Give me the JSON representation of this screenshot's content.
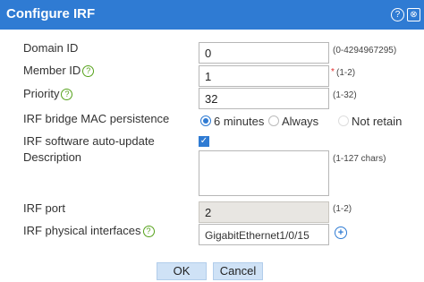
{
  "dialog": {
    "title": "Configure IRF",
    "help_icon": "?",
    "close_icon": "⊗"
  },
  "fields": {
    "domain_id": {
      "label": "Domain ID",
      "value": "0",
      "hint": "(0-4294967295)"
    },
    "member_id": {
      "label": "Member ID",
      "value": "1",
      "hint": "(1-2)",
      "required": "*"
    },
    "priority": {
      "label": "Priority",
      "value": "32",
      "hint": "(1-32)"
    },
    "mac_persistence": {
      "label": "IRF bridge MAC persistence",
      "options": [
        "6 minutes",
        "Always",
        "Not retain"
      ],
      "selected": "6 minutes"
    },
    "auto_update": {
      "label": "IRF software auto-update",
      "checked": "✓"
    },
    "description": {
      "label": "Description",
      "value": "",
      "hint": "(1-127 chars)"
    },
    "irf_port": {
      "label": "IRF port",
      "value": "2",
      "hint": "(1-2)"
    },
    "physical_interfaces": {
      "label": "IRF physical interfaces",
      "value": "GigabitEthernet1/0/15",
      "add_icon": "+"
    }
  },
  "buttons": {
    "ok": "OK",
    "cancel": "Cancel"
  },
  "colors": {
    "titlebar": "#2f7bd3",
    "help": "#55a21a",
    "button": "#cfe2f6"
  }
}
